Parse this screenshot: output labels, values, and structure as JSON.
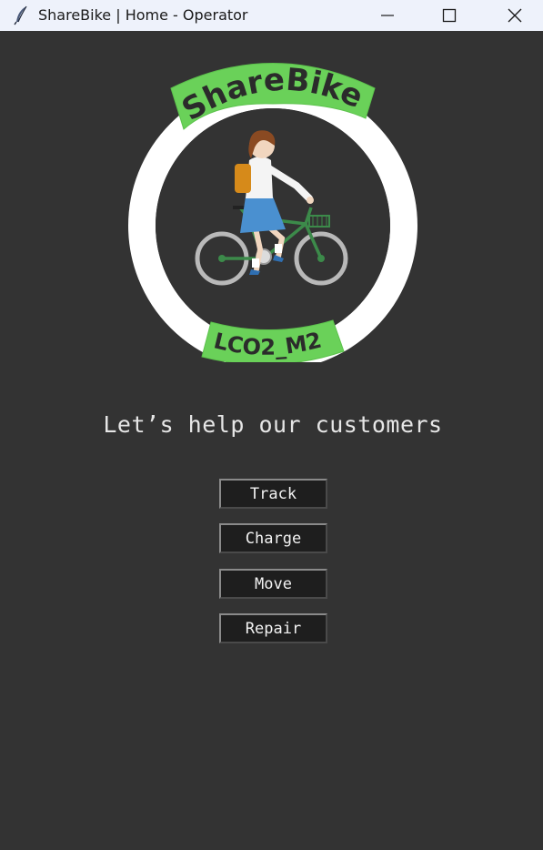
{
  "window": {
    "title": "ShareBike | Home - Operator",
    "icons": [
      "feather-icon",
      "minimize-icon",
      "maximize-icon",
      "close-icon"
    ]
  },
  "logo": {
    "top_banner": "ShareBike",
    "bottom_banner": "LCO2_M2",
    "colors": {
      "ring": "#ffffff",
      "banner": "#6ad159",
      "banner_text": "#2b2b2b"
    },
    "illustration": "girl-riding-bicycle"
  },
  "main": {
    "tagline": "Let’s help our customers",
    "buttons": {
      "track": "Track",
      "charge": "Charge",
      "move": "Move",
      "repair": "Repair"
    }
  },
  "colors": {
    "background": "#333333",
    "titlebar": "#eef2fb",
    "button_bg": "#1e1e1e"
  }
}
